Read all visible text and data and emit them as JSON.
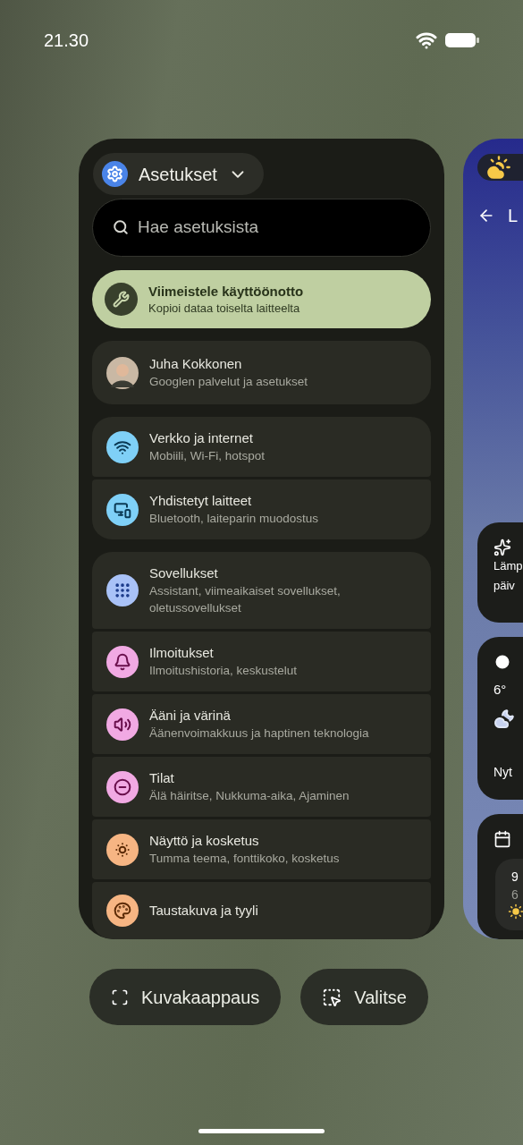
{
  "status_bar": {
    "time": "21.30"
  },
  "settings_card": {
    "app_name": "Asetukset",
    "search": {
      "placeholder": "Hae asetuksista"
    },
    "suggestion": {
      "title": "Viimeistele käyttöönotto",
      "subtitle": "Kopioi dataa toiselta laitteelta"
    },
    "account": {
      "name": "Juha Kokkonen",
      "subtitle": "Googlen palvelut ja asetukset"
    },
    "groups": [
      [
        {
          "title": "Verkko ja internet",
          "subtitle": "Mobiili, Wi-Fi, hotspot",
          "color": "#7fd0f7"
        },
        {
          "title": "Yhdistetyt laitteet",
          "subtitle": "Bluetooth, laiteparin muodostus",
          "color": "#7fd0f7"
        }
      ],
      [
        {
          "title": "Sovellukset",
          "subtitle": "Assistant, viimeaikaiset sovellukset, oletussovellukset",
          "color": "#a9c2f7"
        },
        {
          "title": "Ilmoitukset",
          "subtitle": "Ilmoitushistoria, keskustelut",
          "color": "#f1a9e3"
        },
        {
          "title": "Ääni ja värinä",
          "subtitle": "Äänenvoimakkuus ja haptinen teknologia",
          "color": "#f1a9e3"
        },
        {
          "title": "Tilat",
          "subtitle": "Älä häiritse, Nukkuma-aika, Ajaminen",
          "color": "#f1a9e3"
        },
        {
          "title": "Näyttö ja kosketus",
          "subtitle": "Tumma teema, fonttikoko, kosketus",
          "color": "#f6b583"
        },
        {
          "title": "Taustakuva ja tyyli",
          "color": "#f6b583"
        }
      ]
    ]
  },
  "weather_card": {
    "header": "L",
    "cards": [
      {
        "lines": [
          "Lämp",
          "päiv"
        ]
      },
      {
        "temp": "6°",
        "label": "Nyt"
      },
      {
        "lines": [
          "9",
          "6"
        ]
      }
    ]
  },
  "buttons": [
    "Kuvakaappaus",
    "Valitse"
  ]
}
